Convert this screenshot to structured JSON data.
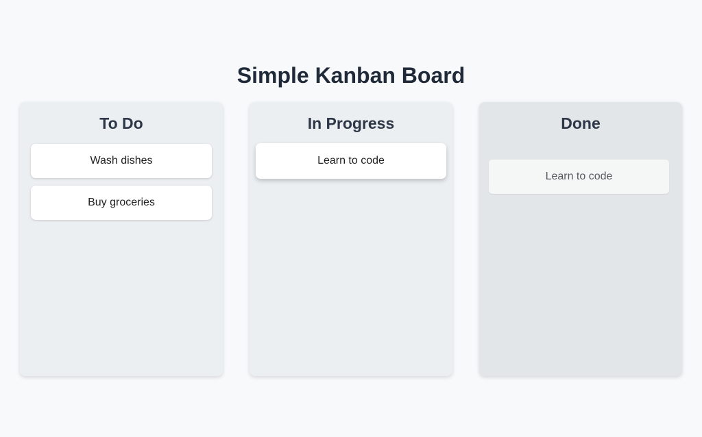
{
  "page": {
    "title": "Simple Kanban Board"
  },
  "columns": [
    {
      "title": "To Do",
      "cards": [
        "Wash dishes",
        "Buy groceries"
      ]
    },
    {
      "title": "In Progress",
      "cards": [
        "Learn to code"
      ]
    },
    {
      "title": "Done",
      "cards": [],
      "drag_preview": "Learn to code"
    }
  ],
  "colors": {
    "background": "#f8f9fb",
    "column_background": "#eceff2",
    "column_background_hover": "#e3e6e9",
    "card_background": "#ffffff",
    "heading_text": "#1f2937"
  }
}
